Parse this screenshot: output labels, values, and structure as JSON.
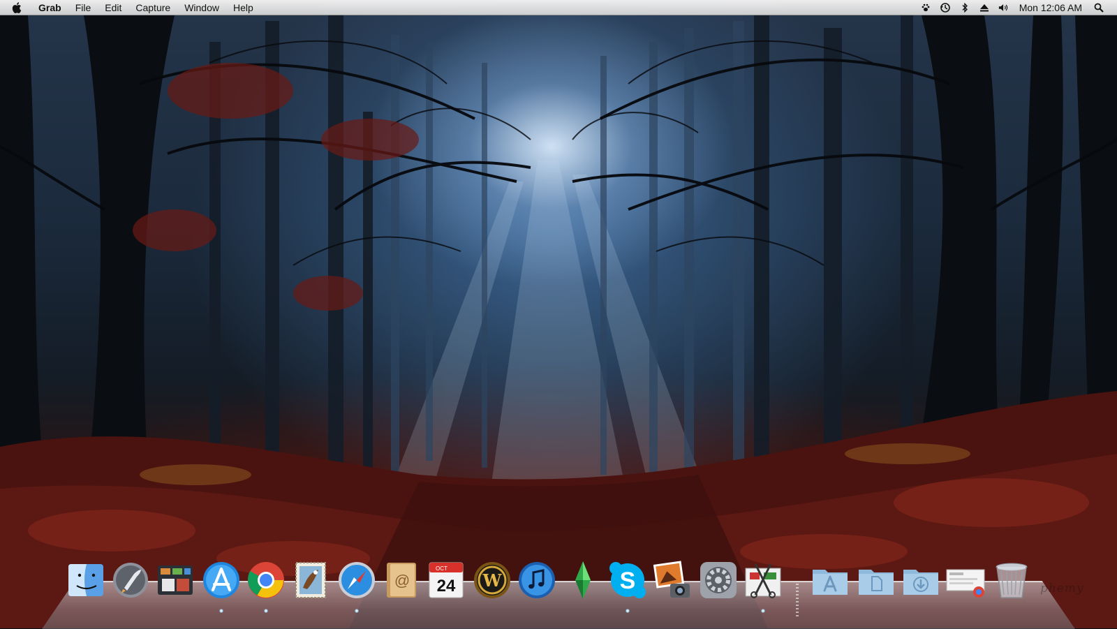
{
  "menubar": {
    "app_name": "Grab",
    "menus": [
      "File",
      "Edit",
      "Capture",
      "Window",
      "Help"
    ],
    "status_icons": [
      "paw-icon",
      "time-machine-icon",
      "bluetooth-icon",
      "eject-icon",
      "volume-icon"
    ],
    "clock": "Mon 12:06 AM"
  },
  "dock": {
    "apps": [
      {
        "name": "Finder",
        "icon": "finder-icon",
        "running": true
      },
      {
        "name": "Launchpad",
        "icon": "launchpad-icon",
        "running": false
      },
      {
        "name": "Mission Control",
        "icon": "mission-control-icon",
        "running": false
      },
      {
        "name": "App Store",
        "icon": "app-store-icon",
        "running": true
      },
      {
        "name": "Google Chrome",
        "icon": "chrome-icon",
        "running": true
      },
      {
        "name": "Mail",
        "icon": "mail-icon",
        "running": false
      },
      {
        "name": "Safari",
        "icon": "safari-icon",
        "running": true
      },
      {
        "name": "Address Book",
        "icon": "address-book-icon",
        "running": false
      },
      {
        "name": "iCal",
        "icon": "calendar-icon",
        "running": false,
        "month": "OCT",
        "day": "24"
      },
      {
        "name": "World of Warcraft",
        "icon": "wow-icon",
        "running": false
      },
      {
        "name": "iTunes",
        "icon": "itunes-icon",
        "running": false
      },
      {
        "name": "The Sims",
        "icon": "sims-plumbob-icon",
        "running": false
      },
      {
        "name": "Skype",
        "icon": "skype-icon",
        "running": true
      },
      {
        "name": "iPhoto",
        "icon": "iphoto-icon",
        "running": false
      },
      {
        "name": "System Preferences",
        "icon": "system-preferences-icon",
        "running": false
      },
      {
        "name": "Grab",
        "icon": "grab-scissors-icon",
        "running": true
      }
    ],
    "stacks": [
      {
        "name": "Applications",
        "icon": "applications-folder-icon"
      },
      {
        "name": "Documents",
        "icon": "documents-folder-icon"
      },
      {
        "name": "Downloads",
        "icon": "downloads-folder-icon"
      },
      {
        "name": "Recent",
        "icon": "chrome-stack-icon"
      },
      {
        "name": "Trash",
        "icon": "trash-icon"
      }
    ],
    "watermark": "phemy"
  }
}
